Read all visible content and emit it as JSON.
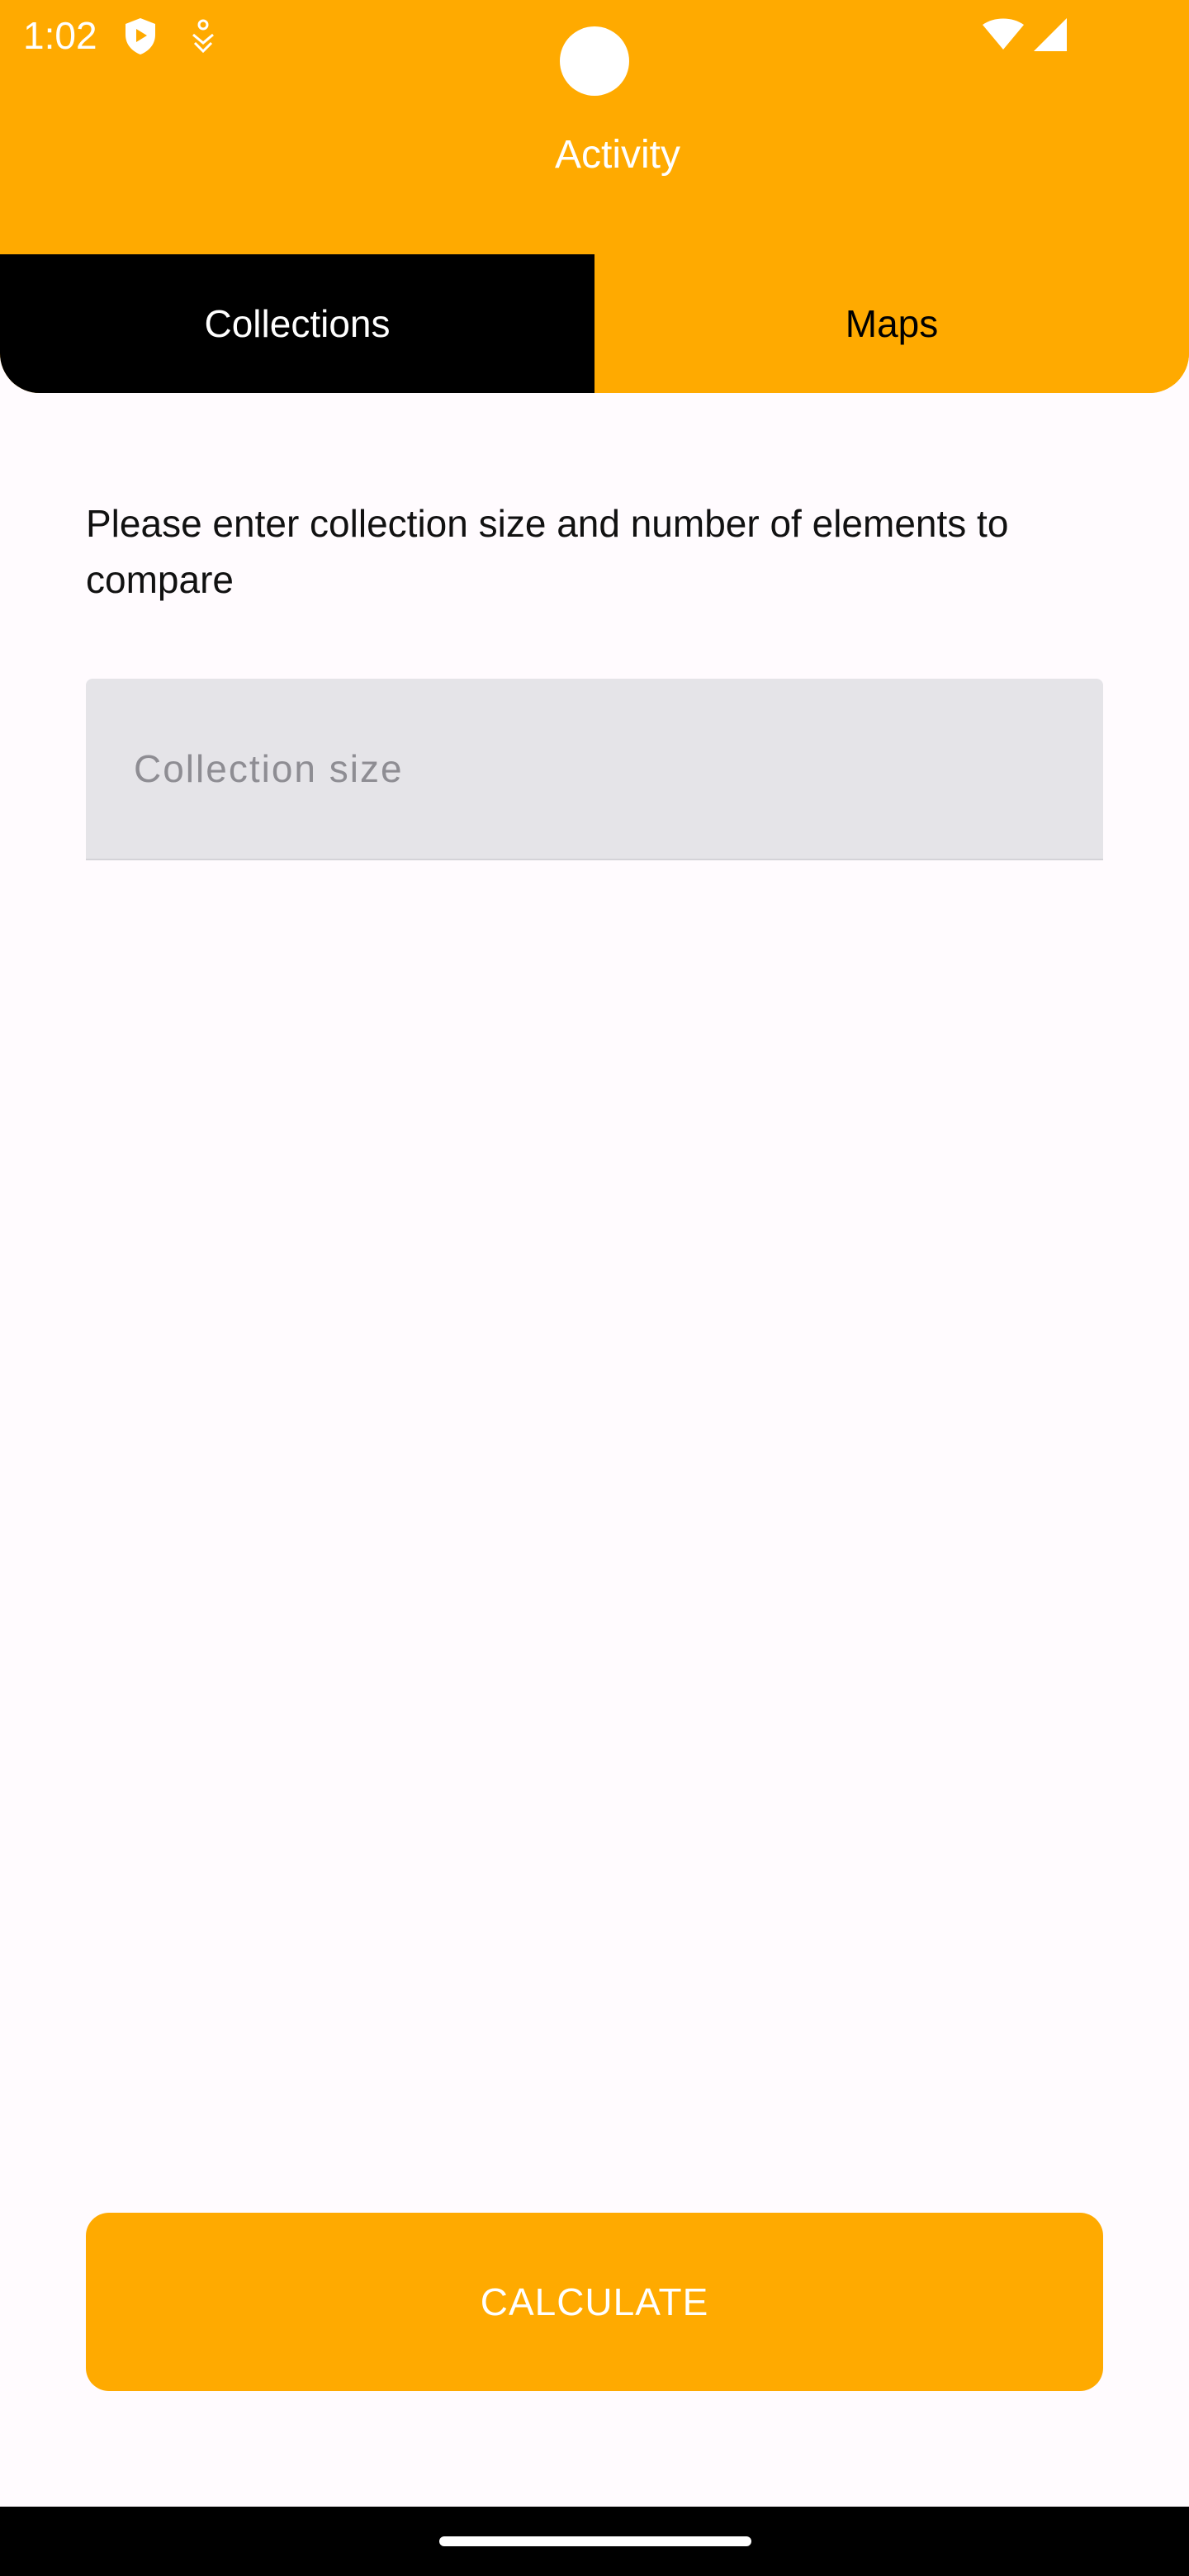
{
  "status_bar": {
    "time": "1:02",
    "icons": [
      "shield-play-icon",
      "person-download-icon",
      "wifi-icon",
      "signal-icon"
    ]
  },
  "header": {
    "title": "Activity",
    "background_color": "#ffaa00"
  },
  "tabs": [
    {
      "label": "Collections",
      "selected": true
    },
    {
      "label": "Maps",
      "selected": false
    }
  ],
  "main": {
    "prompt": "Please enter collection size and number of elements to compare",
    "collection_size_field": {
      "placeholder": "Collection size",
      "value": ""
    },
    "calculate_button": "CALCULATE"
  },
  "colors": {
    "accent": "#ffaa00",
    "active_tab": "#000000",
    "field_background": "#e5e4e8",
    "page_background": "#fffbfe"
  }
}
